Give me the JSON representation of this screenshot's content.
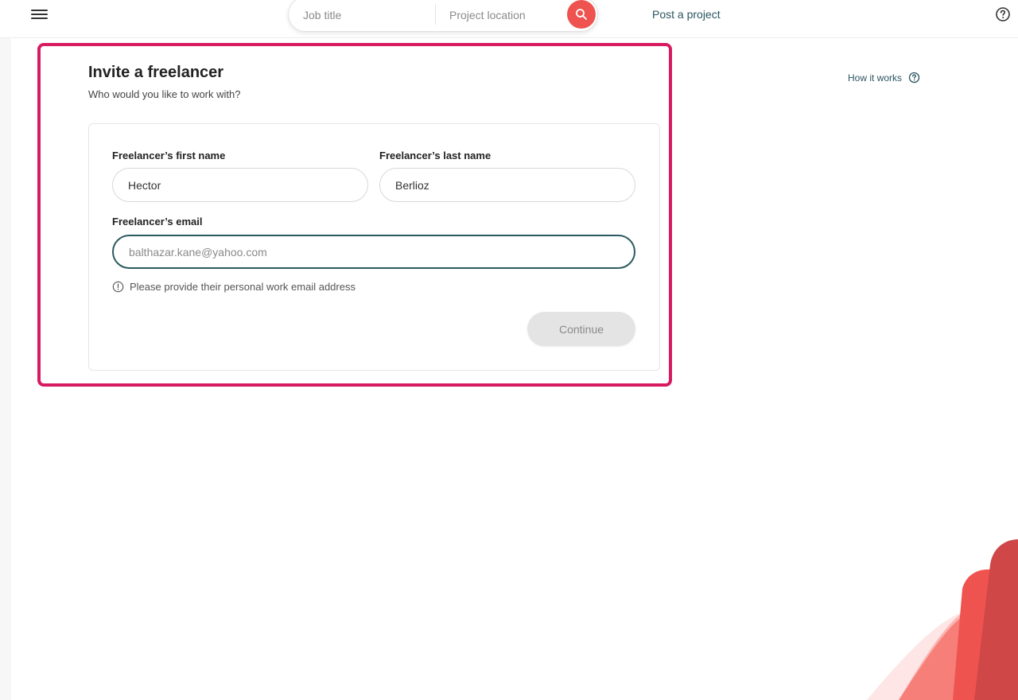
{
  "header": {
    "search": {
      "job_placeholder": "Job title",
      "location_placeholder": "Project location"
    },
    "post_link": "Post a project"
  },
  "page": {
    "title": "Invite a freelancer",
    "subtitle": "Who would you like to work with?",
    "how_it_works": "How it works"
  },
  "form": {
    "first_name_label": "Freelancer’s first name",
    "first_name_value": "Hector",
    "last_name_label": "Freelancer’s last name",
    "last_name_value": "Berlioz",
    "email_label": "Freelancer’s email",
    "email_placeholder": "balthazar.kane@yahoo.com",
    "email_hint": "Please provide their personal work email address",
    "continue_label": "Continue"
  },
  "colors": {
    "accent": "#ef5350",
    "link": "#2a5560",
    "highlight": "#d81b60"
  },
  "icons": [
    "menu-icon",
    "search-icon",
    "help-icon",
    "info-icon"
  ]
}
